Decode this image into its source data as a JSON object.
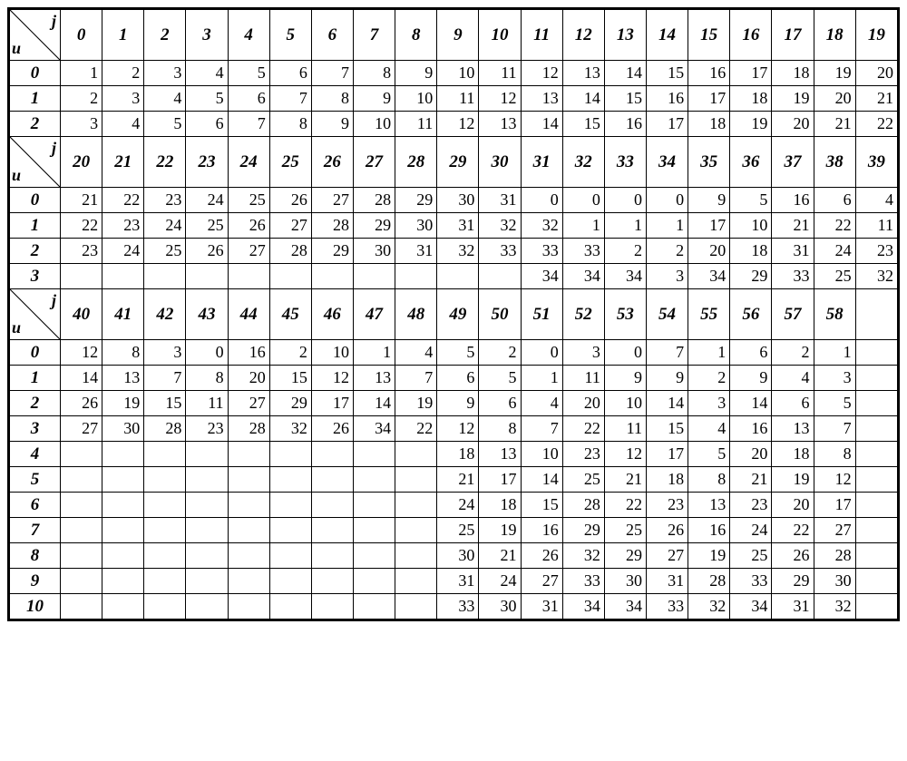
{
  "labels": {
    "j": "j",
    "u": "u"
  },
  "chart_data": {
    "type": "table",
    "sections": [
      {
        "col_headers": [
          "0",
          "1",
          "2",
          "3",
          "4",
          "5",
          "6",
          "7",
          "8",
          "9",
          "10",
          "11",
          "12",
          "13",
          "14",
          "15",
          "16",
          "17",
          "18",
          "19"
        ],
        "rows": [
          {
            "u": "0",
            "cells": [
              "1",
              "2",
              "3",
              "4",
              "5",
              "6",
              "7",
              "8",
              "9",
              "10",
              "11",
              "12",
              "13",
              "14",
              "15",
              "16",
              "17",
              "18",
              "19",
              "20"
            ]
          },
          {
            "u": "1",
            "cells": [
              "2",
              "3",
              "4",
              "5",
              "6",
              "7",
              "8",
              "9",
              "10",
              "11",
              "12",
              "13",
              "14",
              "15",
              "16",
              "17",
              "18",
              "19",
              "20",
              "21"
            ]
          },
          {
            "u": "2",
            "cells": [
              "3",
              "4",
              "5",
              "6",
              "7",
              "8",
              "9",
              "10",
              "11",
              "12",
              "13",
              "14",
              "15",
              "16",
              "17",
              "18",
              "19",
              "20",
              "21",
              "22"
            ]
          }
        ]
      },
      {
        "col_headers": [
          "20",
          "21",
          "22",
          "23",
          "24",
          "25",
          "26",
          "27",
          "28",
          "29",
          "30",
          "31",
          "32",
          "33",
          "34",
          "35",
          "36",
          "37",
          "38",
          "39"
        ],
        "rows": [
          {
            "u": "0",
            "cells": [
              "21",
              "22",
              "23",
              "24",
              "25",
              "26",
              "27",
              "28",
              "29",
              "30",
              "31",
              "0",
              "0",
              "0",
              "0",
              "9",
              "5",
              "16",
              "6",
              "4"
            ]
          },
          {
            "u": "1",
            "cells": [
              "22",
              "23",
              "24",
              "25",
              "26",
              "27",
              "28",
              "29",
              "30",
              "31",
              "32",
              "32",
              "1",
              "1",
              "1",
              "17",
              "10",
              "21",
              "22",
              "11"
            ]
          },
          {
            "u": "2",
            "cells": [
              "23",
              "24",
              "25",
              "26",
              "27",
              "28",
              "29",
              "30",
              "31",
              "32",
              "33",
              "33",
              "33",
              "2",
              "2",
              "20",
              "18",
              "31",
              "24",
              "23"
            ]
          },
          {
            "u": "3",
            "cells": [
              "",
              "",
              "",
              "",
              "",
              "",
              "",
              "",
              "",
              "",
              "",
              "34",
              "34",
              "34",
              "3",
              "34",
              "29",
              "33",
              "25",
              "32"
            ]
          }
        ]
      },
      {
        "col_headers": [
          "40",
          "41",
          "42",
          "43",
          "44",
          "45",
          "46",
          "47",
          "48",
          "49",
          "50",
          "51",
          "52",
          "53",
          "54",
          "55",
          "56",
          "57",
          "58",
          ""
        ],
        "rows": [
          {
            "u": "0",
            "cells": [
              "12",
              "8",
              "3",
              "0",
              "16",
              "2",
              "10",
              "1",
              "4",
              "5",
              "2",
              "0",
              "3",
              "0",
              "7",
              "1",
              "6",
              "2",
              "1",
              ""
            ]
          },
          {
            "u": "1",
            "cells": [
              "14",
              "13",
              "7",
              "8",
              "20",
              "15",
              "12",
              "13",
              "7",
              "6",
              "5",
              "1",
              "11",
              "9",
              "9",
              "2",
              "9",
              "4",
              "3",
              ""
            ]
          },
          {
            "u": "2",
            "cells": [
              "26",
              "19",
              "15",
              "11",
              "27",
              "29",
              "17",
              "14",
              "19",
              "9",
              "6",
              "4",
              "20",
              "10",
              "14",
              "3",
              "14",
              "6",
              "5",
              ""
            ]
          },
          {
            "u": "3",
            "cells": [
              "27",
              "30",
              "28",
              "23",
              "28",
              "32",
              "26",
              "34",
              "22",
              "12",
              "8",
              "7",
              "22",
              "11",
              "15",
              "4",
              "16",
              "13",
              "7",
              ""
            ]
          },
          {
            "u": "4",
            "cells": [
              "",
              "",
              "",
              "",
              "",
              "",
              "",
              "",
              "",
              "18",
              "13",
              "10",
              "23",
              "12",
              "17",
              "5",
              "20",
              "18",
              "8",
              ""
            ]
          },
          {
            "u": "5",
            "cells": [
              "",
              "",
              "",
              "",
              "",
              "",
              "",
              "",
              "",
              "21",
              "17",
              "14",
              "25",
              "21",
              "18",
              "8",
              "21",
              "19",
              "12",
              ""
            ]
          },
          {
            "u": "6",
            "cells": [
              "",
              "",
              "",
              "",
              "",
              "",
              "",
              "",
              "",
              "24",
              "18",
              "15",
              "28",
              "22",
              "23",
              "13",
              "23",
              "20",
              "17",
              ""
            ]
          },
          {
            "u": "7",
            "cells": [
              "",
              "",
              "",
              "",
              "",
              "",
              "",
              "",
              "",
              "25",
              "19",
              "16",
              "29",
              "25",
              "26",
              "16",
              "24",
              "22",
              "27",
              ""
            ]
          },
          {
            "u": "8",
            "cells": [
              "",
              "",
              "",
              "",
              "",
              "",
              "",
              "",
              "",
              "30",
              "21",
              "26",
              "32",
              "29",
              "27",
              "19",
              "25",
              "26",
              "28",
              ""
            ]
          },
          {
            "u": "9",
            "cells": [
              "",
              "",
              "",
              "",
              "",
              "",
              "",
              "",
              "",
              "31",
              "24",
              "27",
              "33",
              "30",
              "31",
              "28",
              "33",
              "29",
              "30",
              ""
            ]
          },
          {
            "u": "10",
            "cells": [
              "",
              "",
              "",
              "",
              "",
              "",
              "",
              "",
              "",
              "33",
              "30",
              "31",
              "34",
              "34",
              "33",
              "32",
              "34",
              "31",
              "32",
              ""
            ]
          }
        ]
      }
    ]
  }
}
